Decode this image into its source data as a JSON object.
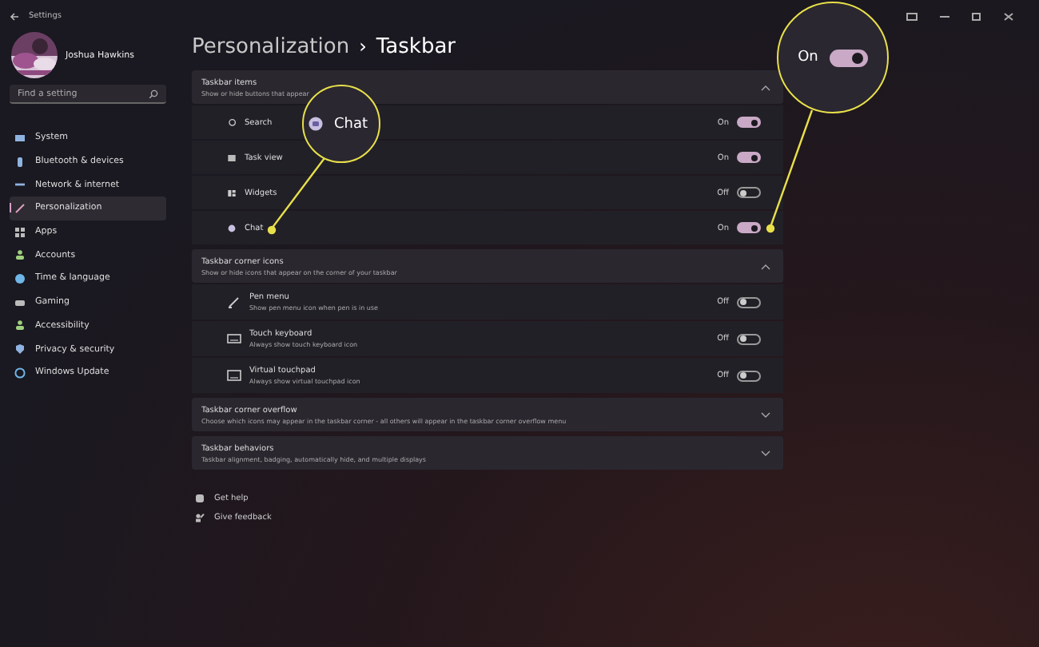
{
  "window": {
    "title": "Settings"
  },
  "user": {
    "name": "Joshua Hawkins"
  },
  "search": {
    "placeholder": "Find a setting"
  },
  "nav": [
    {
      "label": "System",
      "selected": false
    },
    {
      "label": "Bluetooth & devices",
      "selected": false
    },
    {
      "label": "Network & internet",
      "selected": false
    },
    {
      "label": "Personalization",
      "selected": true
    },
    {
      "label": "Apps",
      "selected": false
    },
    {
      "label": "Accounts",
      "selected": false
    },
    {
      "label": "Time & language",
      "selected": false
    },
    {
      "label": "Gaming",
      "selected": false
    },
    {
      "label": "Accessibility",
      "selected": false
    },
    {
      "label": "Privacy & security",
      "selected": false
    },
    {
      "label": "Windows Update",
      "selected": false
    }
  ],
  "breadcrumb": {
    "parent": "Personalization",
    "separator": "›",
    "current": "Taskbar"
  },
  "sections": [
    {
      "title": "Taskbar items",
      "subtitle": "Show or hide buttons that appear",
      "expanded": true,
      "items": [
        {
          "label": "Search",
          "status": "On",
          "on": true
        },
        {
          "label": "Task view",
          "status": "On",
          "on": true
        },
        {
          "label": "Widgets",
          "status": "Off",
          "on": false
        },
        {
          "label": "Chat",
          "status": "On",
          "on": true
        }
      ]
    },
    {
      "title": "Taskbar corner icons",
      "subtitle": "Show or hide icons that appear on the corner of your taskbar",
      "expanded": true,
      "items": [
        {
          "label": "Pen menu",
          "description": "Show pen menu icon when pen is in use",
          "status": "Off",
          "on": false
        },
        {
          "label": "Touch keyboard",
          "description": "Always show touch keyboard icon",
          "status": "Off",
          "on": false
        },
        {
          "label": "Virtual touchpad",
          "description": "Always show virtual touchpad icon",
          "status": "Off",
          "on": false
        }
      ]
    },
    {
      "title": "Taskbar corner overflow",
      "subtitle": "Choose which icons may appear in the taskbar corner - all others will appear in the taskbar corner overflow menu",
      "expanded": false
    },
    {
      "title": "Taskbar behaviors",
      "subtitle": "Taskbar alignment, badging, automatically hide, and multiple displays",
      "expanded": false
    }
  ],
  "footer_links": [
    "Get help",
    "Give feedback"
  ],
  "callouts": [
    {
      "kind": "label",
      "text": "Chat"
    },
    {
      "kind": "toggle",
      "status": "On",
      "on": true
    }
  ]
}
